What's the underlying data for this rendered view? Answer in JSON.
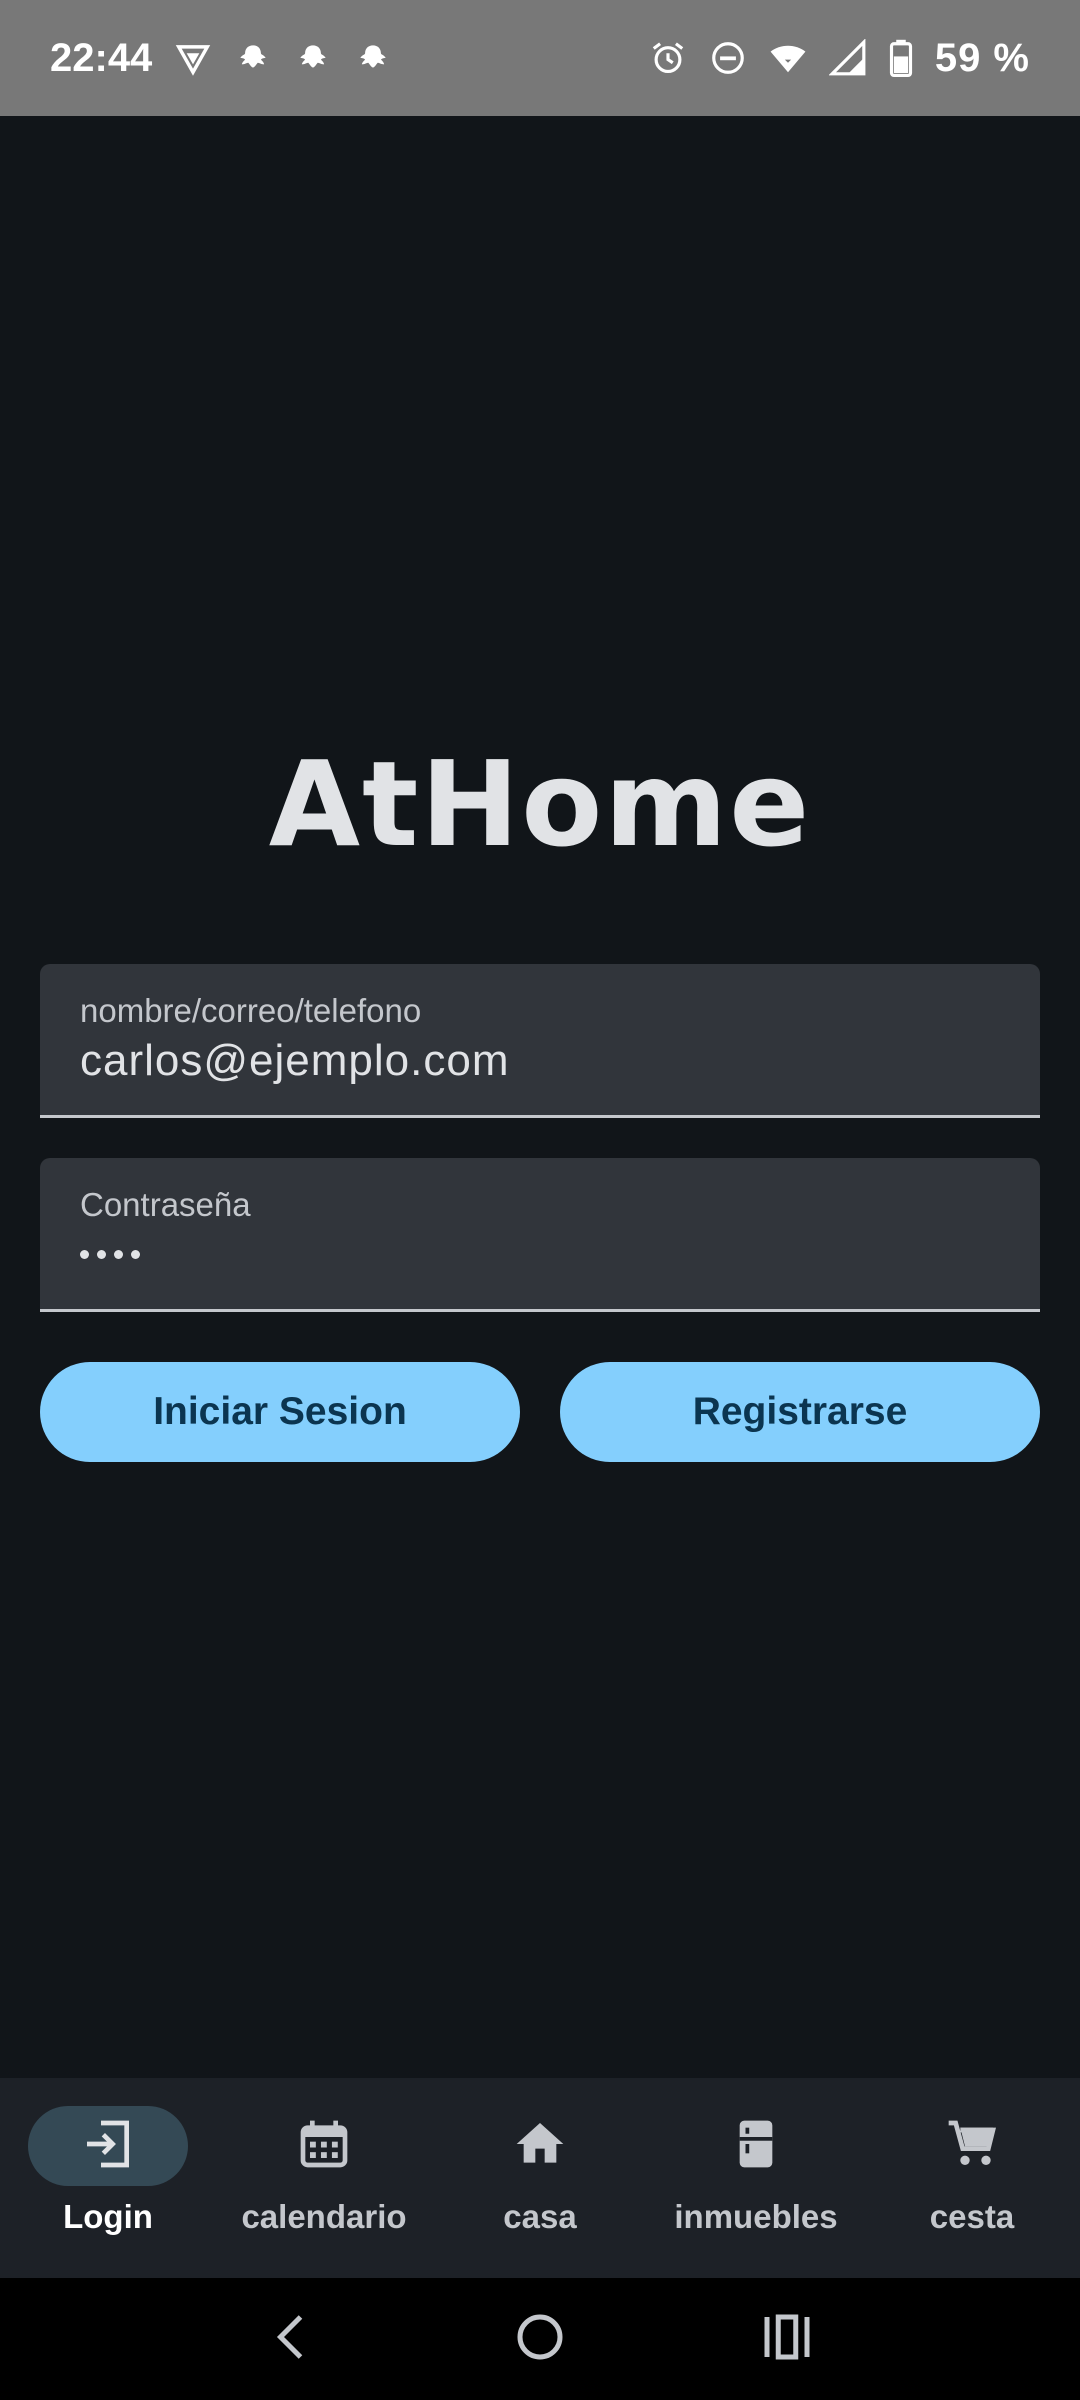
{
  "status_bar": {
    "time": "22:44",
    "battery": "59 %",
    "left_icons": [
      "vpn-shield-icon",
      "bug-icon",
      "bug-icon",
      "bug-icon"
    ],
    "right_icons": [
      "alarm-icon",
      "do-not-disturb-icon",
      "wifi-icon",
      "signal-icon",
      "battery-icon"
    ]
  },
  "logo": {
    "text": "AtHome"
  },
  "form": {
    "username": {
      "label": "nombre/correo/telefono",
      "value": "carlos@ejemplo.com"
    },
    "password": {
      "label": "Contraseña",
      "masked_length": 4
    }
  },
  "buttons": {
    "login": "Iniciar Sesion",
    "register": "Registrarse"
  },
  "bottom_nav": {
    "active": "Login",
    "items": [
      {
        "label": "Login",
        "icon": "login-icon"
      },
      {
        "label": "calendario",
        "icon": "calendar-icon"
      },
      {
        "label": "casa",
        "icon": "home-icon"
      },
      {
        "label": "inmuebles",
        "icon": "fridge-icon"
      },
      {
        "label": "cesta",
        "icon": "cart-icon"
      }
    ]
  },
  "colors": {
    "background": "#111519",
    "accent": "#84cffd",
    "status_bar": "#787878",
    "nav_bar": "#1d2127"
  }
}
